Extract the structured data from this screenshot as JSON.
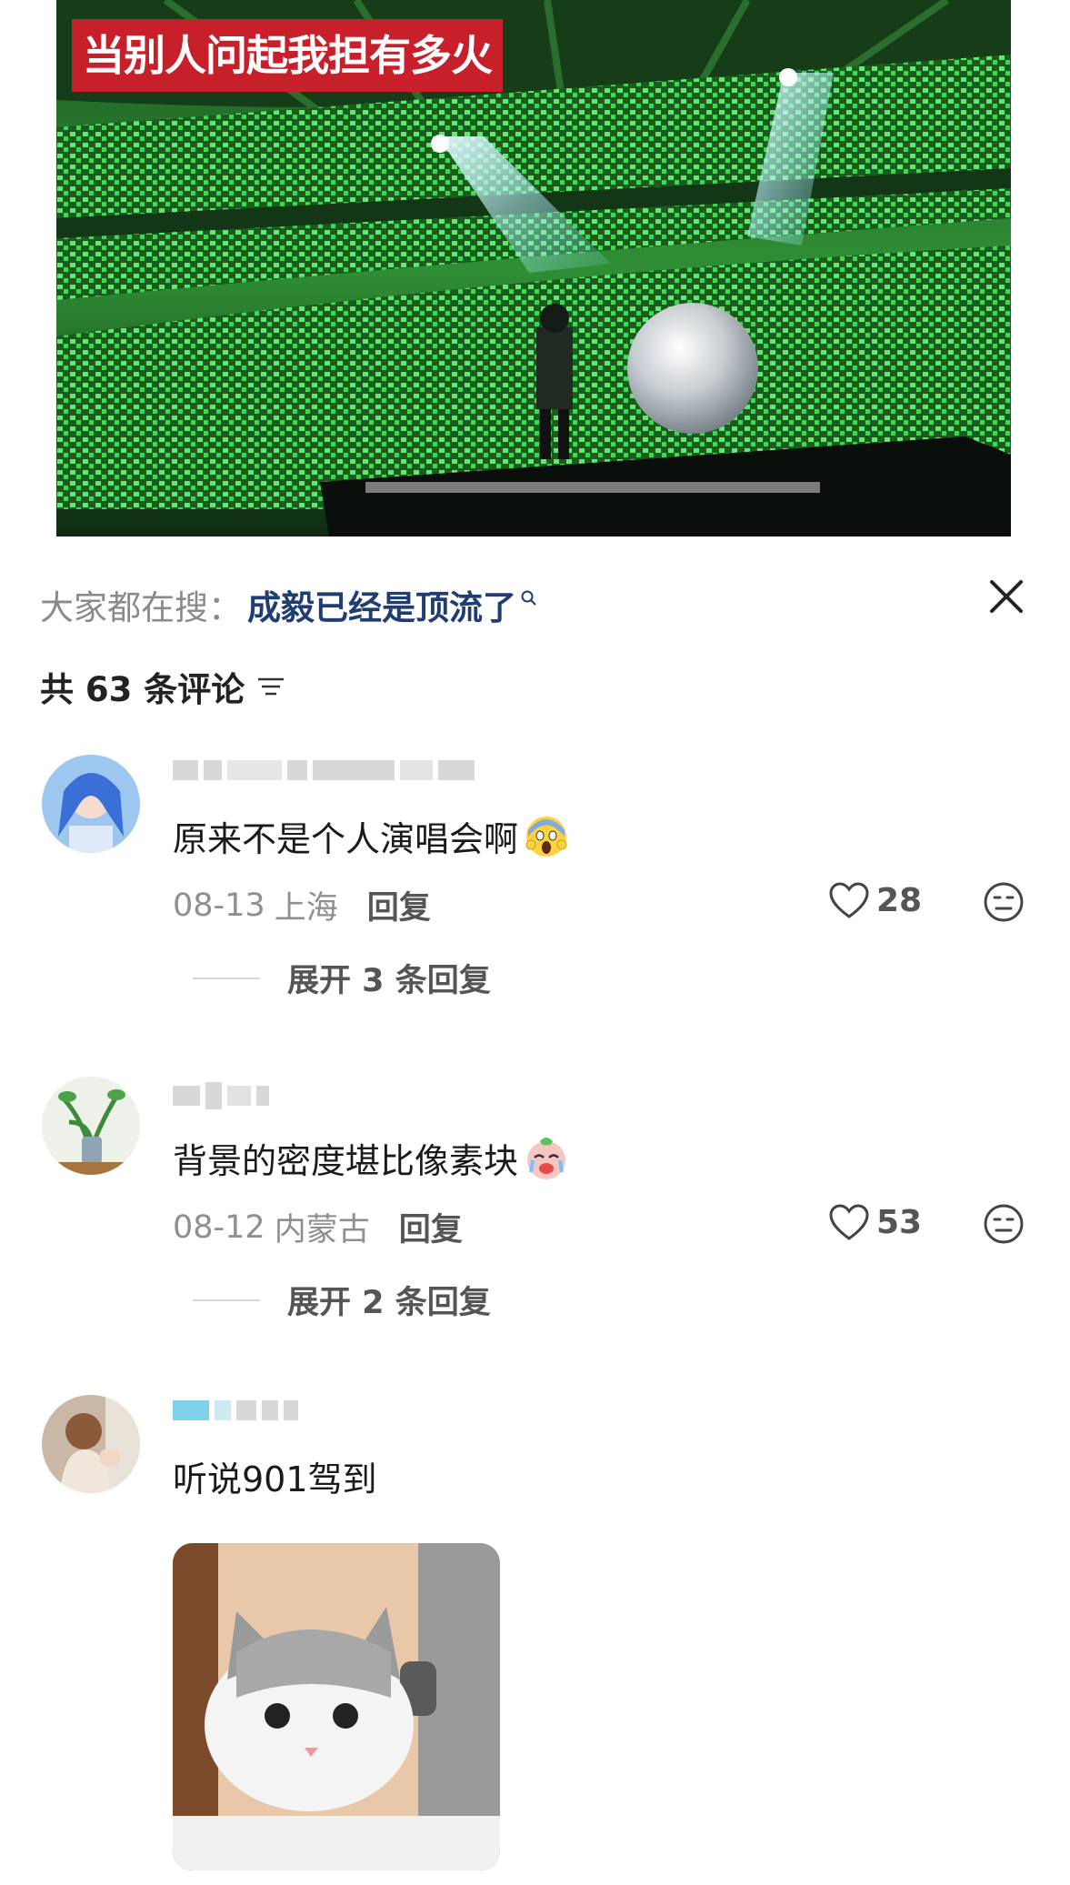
{
  "video": {
    "caption": "当别人问起我担有多火"
  },
  "sheet": {
    "search_prefix": "大家都在搜：",
    "search_term": "成毅已经是顶流了",
    "comment_count_label": "共 63 条评论"
  },
  "comments": [
    {
      "text": "原来不是个人演唱会啊",
      "emoji": "screaming-face-emoji",
      "date": "08-13",
      "location": "上海",
      "reply_label": "回复",
      "likes": "28",
      "expand_label": "展开 3 条回复"
    },
    {
      "text": "背景的密度堪比像素块",
      "emoji": "crying-face-emoji",
      "date": "08-12",
      "location": "内蒙古",
      "reply_label": "回复",
      "likes": "53",
      "expand_label": "展开 2 条回复"
    },
    {
      "text": "听说901驾到",
      "image": "cat-sticker"
    }
  ],
  "colors": {
    "search_term": "#1f3d72",
    "caption_bg": "#c8202a",
    "stage_green": "#3fe05a"
  }
}
